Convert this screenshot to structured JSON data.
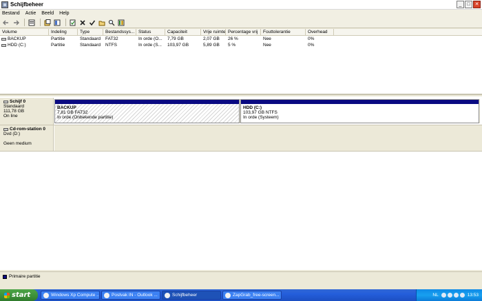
{
  "window": {
    "title": "Schijfbeheer"
  },
  "menu": [
    "Bestand",
    "Actie",
    "Beeld",
    "Help"
  ],
  "toolbar": [
    {
      "name": "back-icon",
      "glyph": "←"
    },
    {
      "name": "forward-icon",
      "glyph": "→"
    },
    {
      "name": "properties-icon",
      "glyph": "▦"
    },
    {
      "name": "help-icon",
      "glyph": "▣"
    },
    {
      "name": "export-icon",
      "glyph": "▧"
    },
    {
      "name": "delete-icon",
      "glyph": "✕"
    },
    {
      "name": "check-icon",
      "glyph": "✔"
    },
    {
      "name": "open-icon",
      "glyph": "▤"
    },
    {
      "name": "search-icon",
      "glyph": "⌕"
    },
    {
      "name": "view-icon",
      "glyph": "▥"
    }
  ],
  "table": {
    "headers": [
      "Volume",
      "Indeling",
      "Type",
      "Bestandssys...",
      "Status",
      "Capaciteit",
      "Vrije ruimte",
      "Percentage vrij",
      "Fouttolerantie",
      "Overhead"
    ],
    "rows": [
      [
        "BACKUP",
        "Partitie",
        "Standaard",
        "FAT32",
        "In orde (O...",
        "7,79 GB",
        "2,07 GB",
        "26 %",
        "Nee",
        "0%"
      ],
      [
        "HDD (C:)",
        "Partitie",
        "Standaard",
        "NTFS",
        "In orde (S...",
        "103,97 GB",
        "5,89 GB",
        "5 %",
        "Nee",
        "0%"
      ]
    ]
  },
  "disks": {
    "disk0": {
      "name": "Schijf 0",
      "type": "Standaard",
      "size": "111,78 GB",
      "status": "On line",
      "partitions": [
        {
          "name": "BACKUP",
          "detail": "7,81 GB FAT32",
          "status": "In orde (Onbekende partitie)"
        },
        {
          "name": "HDD  (C:)",
          "detail": "103,97 GB NTFS",
          "status": "In orde (Systeem)"
        }
      ]
    },
    "cdrom0": {
      "name": "Cd-rom-station 0",
      "type": "Dvd (D:)",
      "status": "Geen medium"
    }
  },
  "legend": {
    "label": "Primaire partitie",
    "color": "#0a0a82"
  },
  "taskbar": {
    "start": "start",
    "tasks": [
      "Windows Xp Compute ...",
      "Postvak IN - Outlook ...",
      "Schijfbeheer",
      "ZapGrab_free-screen..."
    ],
    "lang": "NL",
    "clock": "13:53"
  }
}
